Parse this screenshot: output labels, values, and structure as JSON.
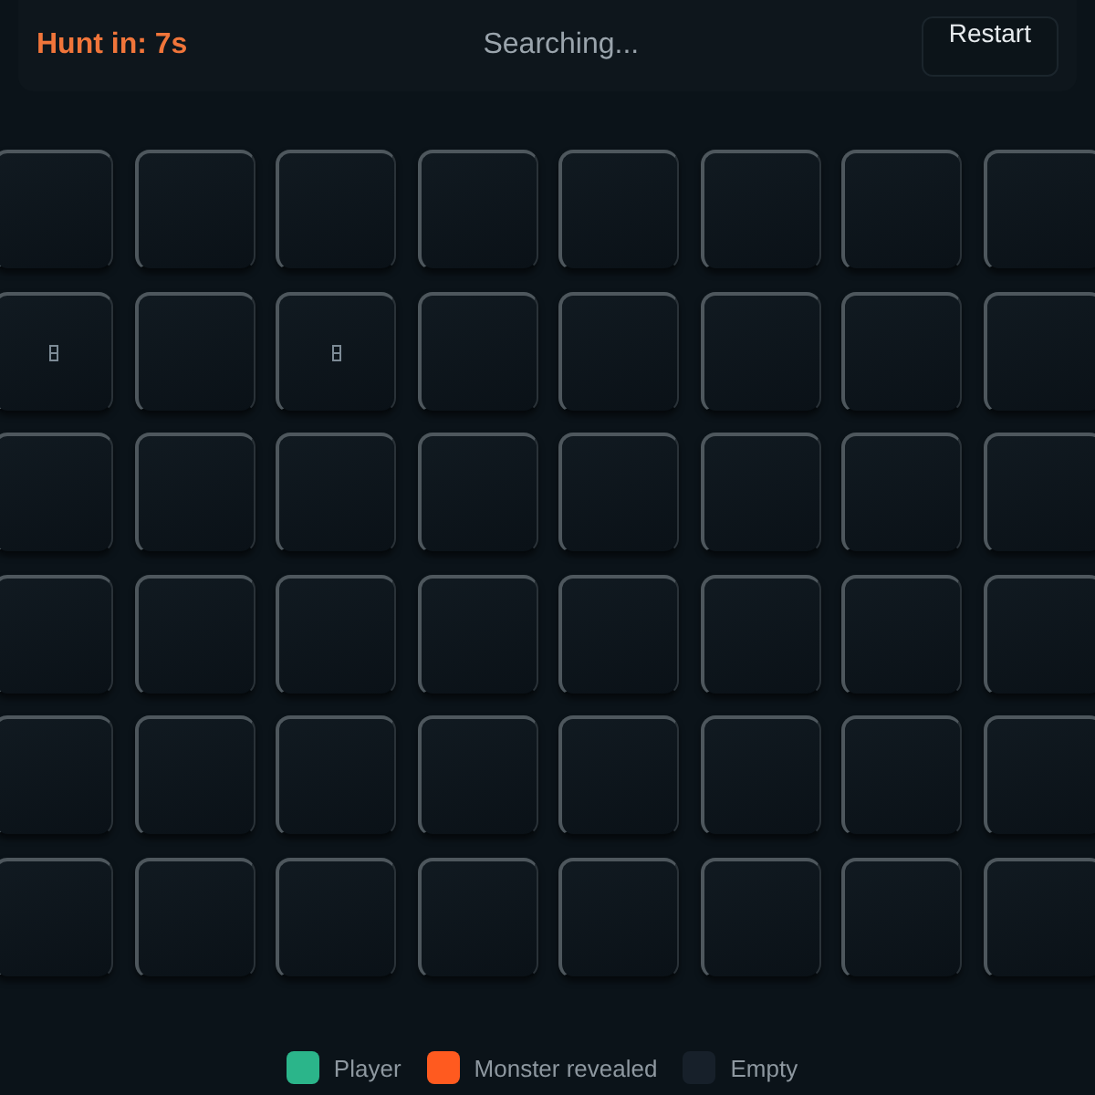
{
  "header": {
    "timer": "Hunt in: 7s",
    "status": "Searching...",
    "restart_button": "Restart"
  },
  "grid": [
    [
      {
        "kind": "empty"
      },
      {
        "kind": "empty"
      },
      {
        "kind": "empty"
      },
      {
        "kind": "empty"
      },
      {
        "kind": "empty"
      },
      {
        "kind": "empty"
      },
      {
        "kind": "empty"
      },
      {
        "kind": "empty"
      }
    ],
    [
      {
        "kind": "glyph"
      },
      {
        "kind": "empty"
      },
      {
        "kind": "glyph"
      },
      {
        "kind": "empty"
      },
      {
        "kind": "empty"
      },
      {
        "kind": "empty"
      },
      {
        "kind": "empty"
      },
      {
        "kind": "empty"
      }
    ],
    [
      {
        "kind": "empty"
      },
      {
        "kind": "empty"
      },
      {
        "kind": "empty"
      },
      {
        "kind": "empty"
      },
      {
        "kind": "empty"
      },
      {
        "kind": "empty"
      },
      {
        "kind": "empty"
      },
      {
        "kind": "empty"
      }
    ],
    [
      {
        "kind": "empty"
      },
      {
        "kind": "empty"
      },
      {
        "kind": "empty"
      },
      {
        "kind": "empty"
      },
      {
        "kind": "empty"
      },
      {
        "kind": "empty"
      },
      {
        "kind": "empty"
      },
      {
        "kind": "empty"
      }
    ],
    [
      {
        "kind": "empty"
      },
      {
        "kind": "empty"
      },
      {
        "kind": "empty"
      },
      {
        "kind": "empty"
      },
      {
        "kind": "empty"
      },
      {
        "kind": "empty"
      },
      {
        "kind": "empty"
      },
      {
        "kind": "empty"
      }
    ],
    [
      {
        "kind": "empty"
      },
      {
        "kind": "empty"
      },
      {
        "kind": "empty"
      },
      {
        "kind": "empty"
      },
      {
        "kind": "empty"
      },
      {
        "kind": "empty"
      },
      {
        "kind": "empty"
      },
      {
        "kind": "empty"
      }
    ]
  ],
  "legend": [
    {
      "label": "Player",
      "color": "#2bb58a"
    },
    {
      "label": "Monster revealed",
      "color": "#ff5a1f"
    },
    {
      "label": "Empty",
      "color": "#17202a"
    }
  ]
}
